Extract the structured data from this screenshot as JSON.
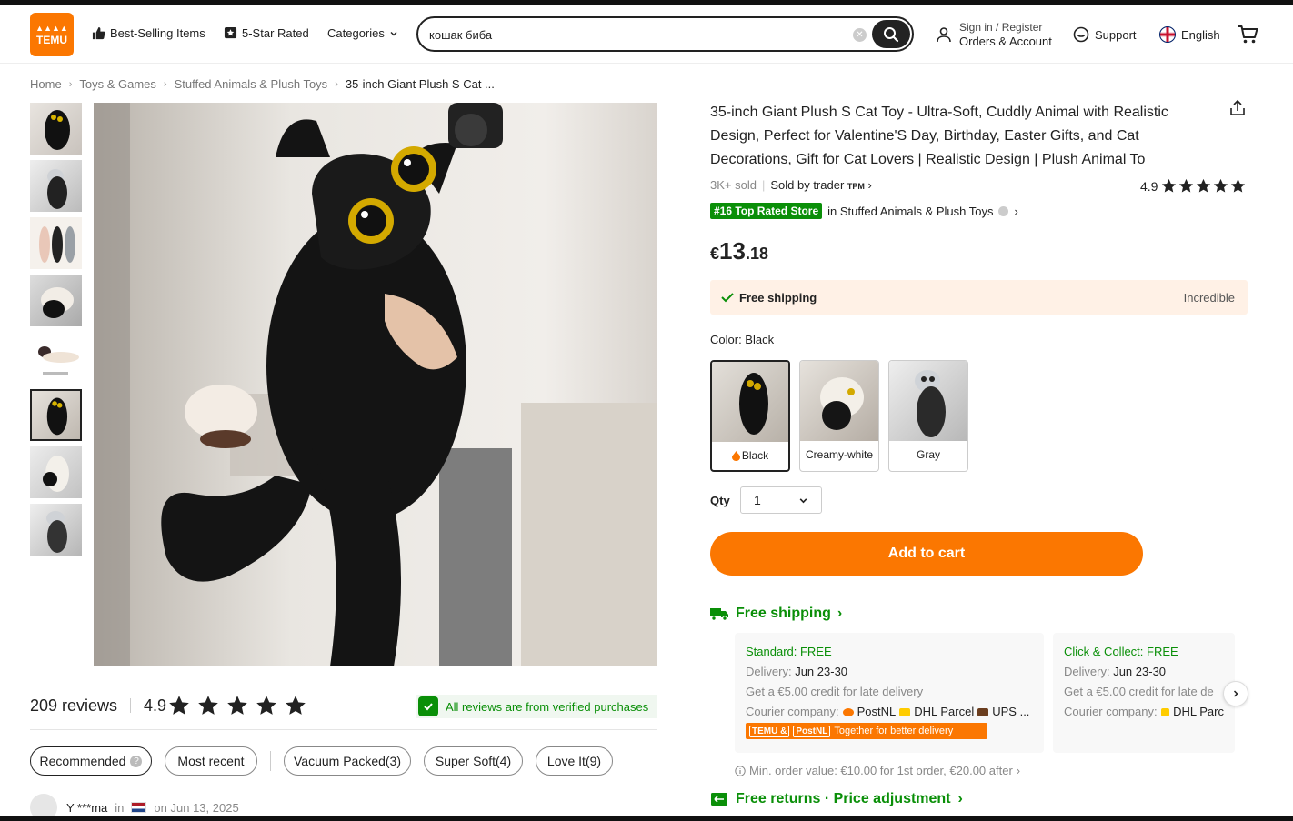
{
  "header": {
    "logo_line1": "▲▲▲▲",
    "logo_line2": "TEMU",
    "nav": [
      "Best-Selling Items",
      "5-Star Rated",
      "Categories"
    ],
    "search_value": "кошак биба",
    "account_line1": "Sign in / Register",
    "account_line2": "Orders & Account",
    "support": "Support",
    "language": "English"
  },
  "breadcrumb": [
    "Home",
    "Toys & Games",
    "Stuffed Animals & Plush Toys",
    "35-inch Giant Plush S Cat ..."
  ],
  "product": {
    "title": "35-inch Giant Plush S Cat Toy - Ultra-Soft, Cuddly Animal with Realistic Design, Perfect for Valentine'S Day, Birthday, Easter Gifts, and Cat Decorations, Gift for Cat Lovers | Realistic Design | Plush Animal To",
    "sold": "3K+ sold",
    "sold_by": "Sold by trader",
    "seller_mark": "TPM",
    "rating": "4.9",
    "rating_stars": 5,
    "top_badge": "#16 Top Rated Store",
    "top_category": "in Stuffed Animals & Plush Toys",
    "price_currency": "€",
    "price_whole": "13",
    "price_cents": ".18",
    "shipping_banner": "Free shipping",
    "shipping_banner_right": "Incredible",
    "color_label": "Color: Black",
    "colors": [
      "Black",
      "Creamy-white",
      "Gray"
    ],
    "qty_label": "Qty",
    "qty_value": "1",
    "add_to_cart": "Add to cart"
  },
  "shipping": {
    "heading": "Free shipping",
    "options": [
      {
        "title": "Standard: FREE",
        "delivery_label": "Delivery:",
        "delivery_dates": "Jun 23-30",
        "credit": "Get a €5.00 credit for late delivery",
        "courier_label": "Courier company:",
        "couriers": [
          "PostNL",
          "DHL Parcel",
          "UPS ..."
        ]
      },
      {
        "title": "Click & Collect: FREE",
        "delivery_label": "Delivery:",
        "delivery_dates": "Jun 23-30",
        "credit": "Get a €5.00 credit for late de",
        "courier_label": "Courier company:",
        "couriers": [
          "DHL Parc"
        ]
      }
    ],
    "together_logo1": "TEMU &",
    "together_logo2": "PostNL",
    "together_text": "Together for better delivery",
    "min_order": "Min. order value: €10.00 for 1st order, €20.00 after",
    "returns": "Free returns · Price adjustment"
  },
  "reviews": {
    "count": "209 reviews",
    "rating": "4.9",
    "verified": "All reviews are from verified purchases",
    "filters": [
      "Recommended",
      "Most recent",
      "Vacuum Packed(3)",
      "Super Soft(4)",
      "Love It(9)"
    ],
    "first_reviewer": "Y ***ma",
    "first_in": "in",
    "first_date": "on Jun 13, 2025"
  },
  "colors": {
    "brand": "#fb7701",
    "green": "#0a8f08",
    "dark": "#222222"
  }
}
